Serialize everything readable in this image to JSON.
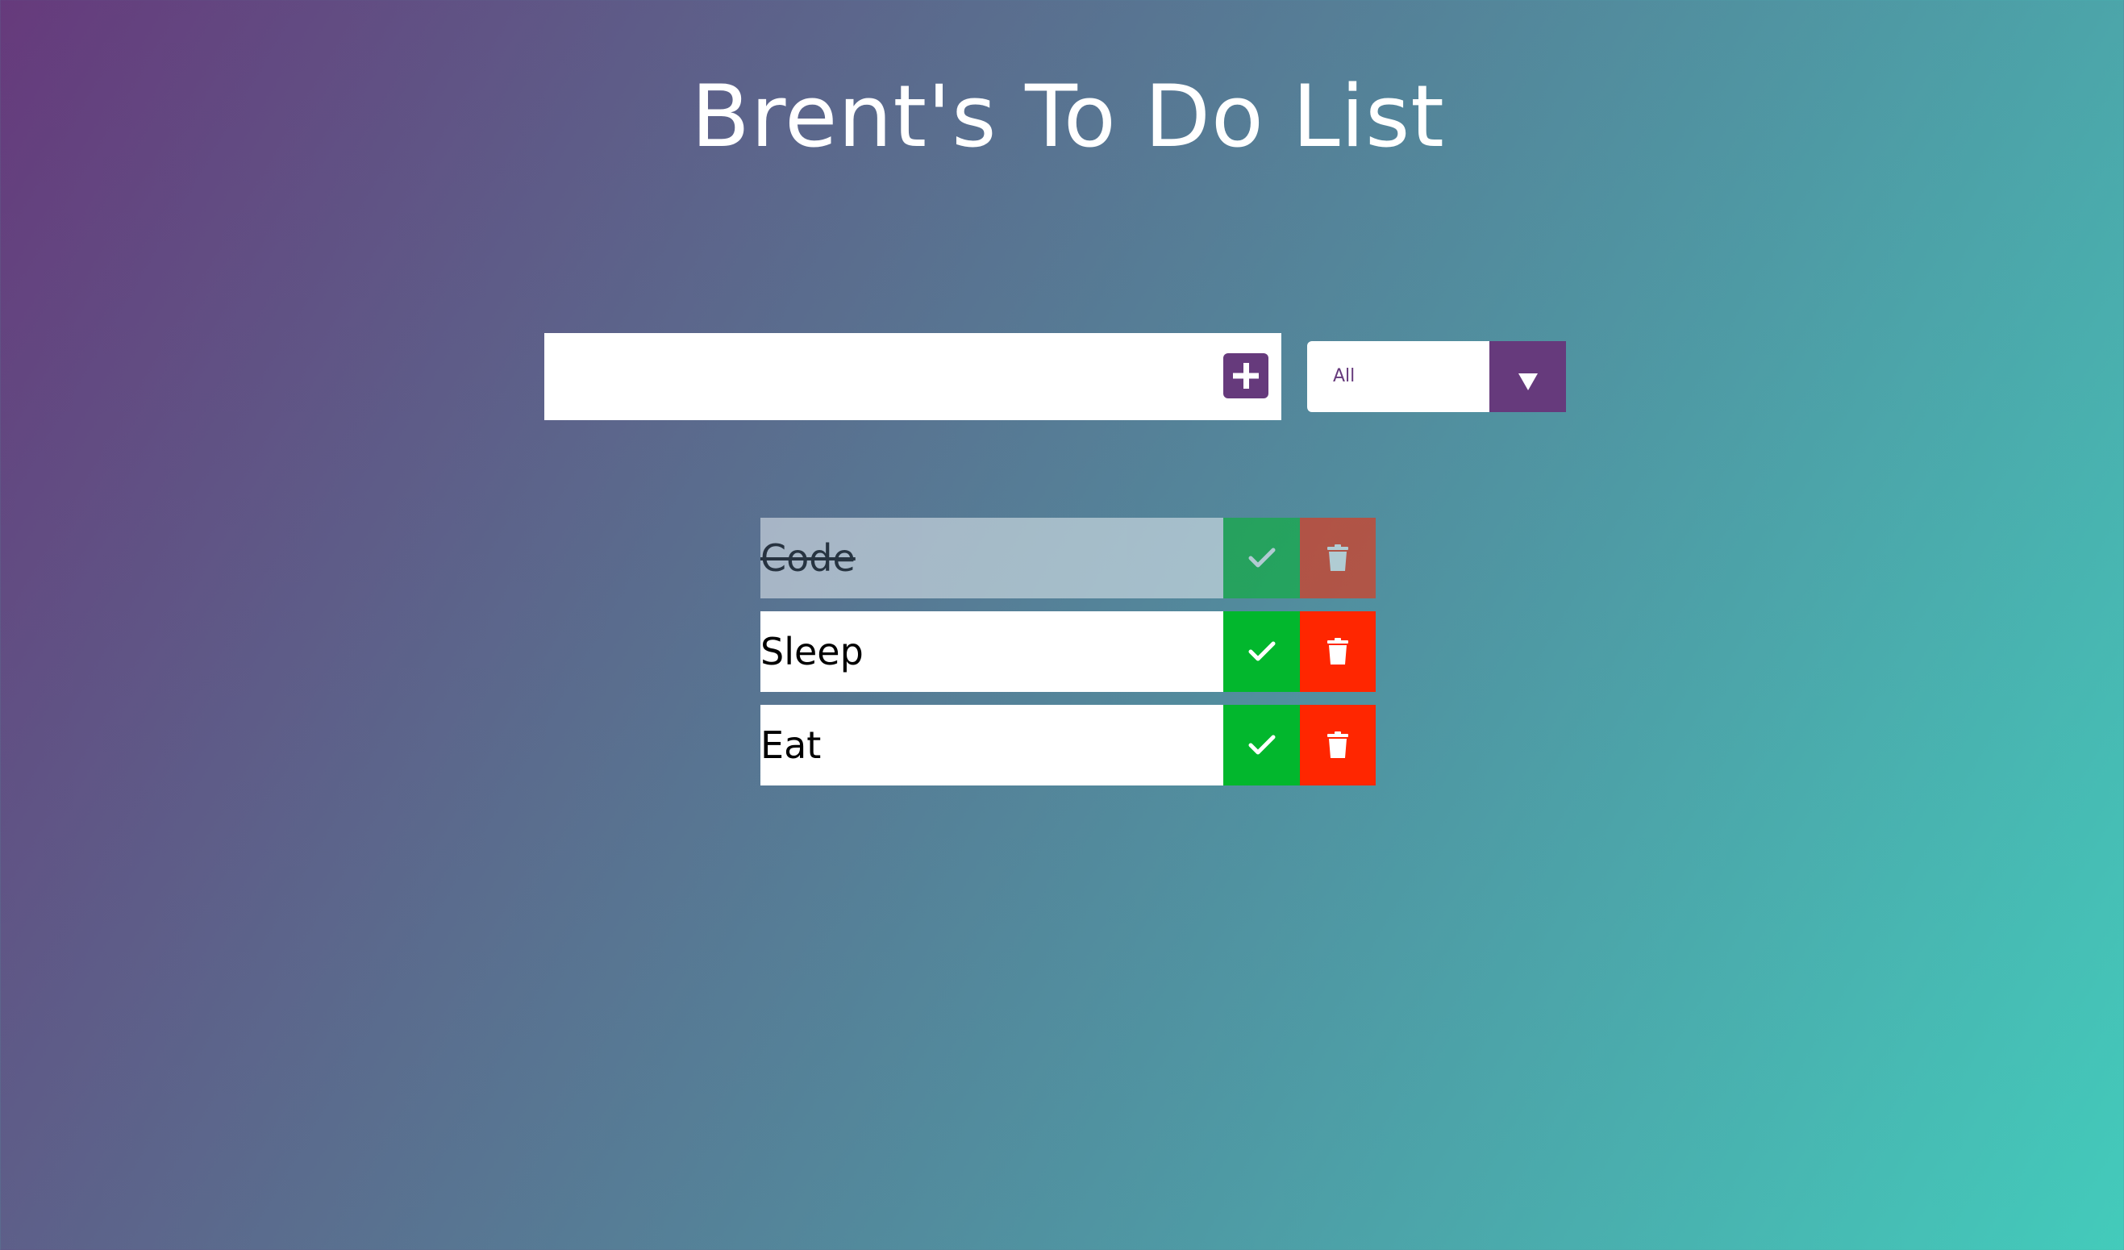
{
  "header": {
    "title": "Brent's To Do List"
  },
  "form": {
    "input_value": "",
    "input_placeholder": "",
    "add_icon": "plus-square-icon",
    "filter_selected": "All",
    "filter_arrow_icon": "caret-down-icon"
  },
  "todos": [
    {
      "text": "Code",
      "completed": true,
      "check_icon": "check-icon",
      "trash_icon": "trash-icon"
    },
    {
      "text": "Sleep",
      "completed": false,
      "check_icon": "check-icon",
      "trash_icon": "trash-icon"
    },
    {
      "text": "Eat",
      "completed": false,
      "check_icon": "check-icon",
      "trash_icon": "trash-icon"
    }
  ],
  "colors": {
    "accent_purple": "#663a7c",
    "complete_green": "#02b72d",
    "trash_red": "#ff2600",
    "gradient_start": "#663a7c",
    "gradient_end": "#43cbbb"
  }
}
